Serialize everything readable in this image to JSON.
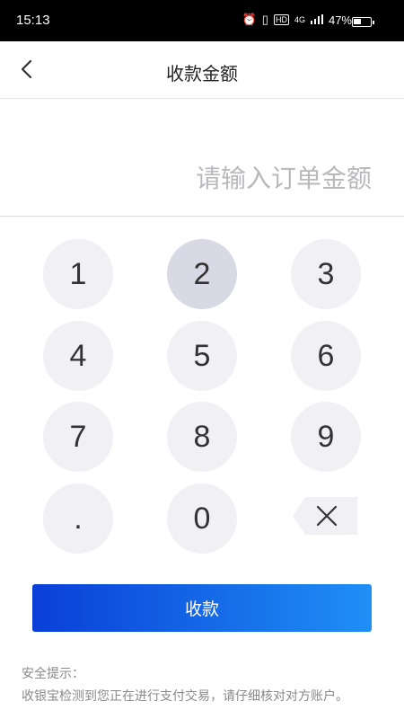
{
  "status_bar": {
    "time": "15:13",
    "network": "4G",
    "battery": "47%",
    "hd_badge": "HD",
    "icons": [
      "alarm-icon",
      "vibrate-icon",
      "hd-icon",
      "signal-icon",
      "battery-icon"
    ]
  },
  "nav": {
    "title": "收款金额",
    "back_icon": "chevron-left-icon"
  },
  "amount": {
    "value": "",
    "placeholder": "请输入订单金额"
  },
  "keypad": {
    "keys": [
      "1",
      "2",
      "3",
      "4",
      "5",
      "6",
      "7",
      "8",
      "9",
      ".",
      "0"
    ],
    "pressed_key": "2",
    "delete_icon": "backspace-icon"
  },
  "submit": {
    "label": "收款"
  },
  "tips": {
    "title": "安全提示：",
    "body": "收银宝检测到您正在进行支付交易，请仔细核对对方账户。"
  },
  "colors": {
    "key_bg": "#f1f1f5",
    "key_pressed_bg": "#d9d9e6",
    "button_gradient_start": "#0a3fd8",
    "button_gradient_end": "#1f8ff5"
  }
}
